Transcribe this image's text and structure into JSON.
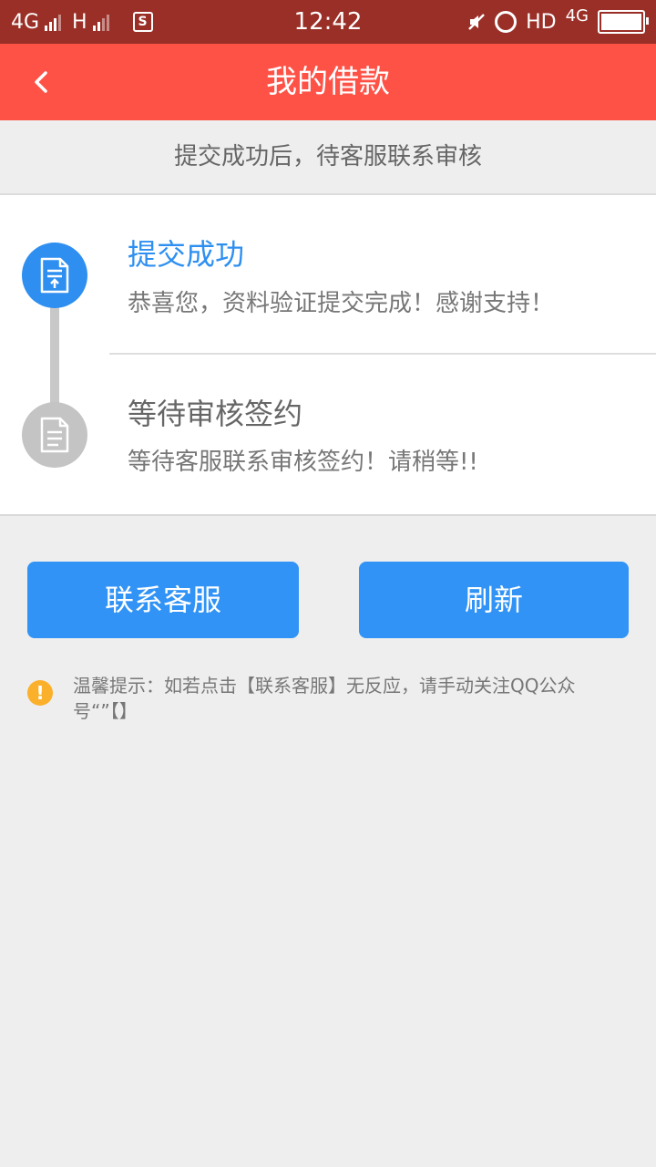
{
  "status_bar": {
    "network_1": "4G",
    "network_2": "H",
    "sim_icon_text": "S",
    "time": "12:42",
    "hd_label": "HD",
    "network_3": "4G"
  },
  "header": {
    "title": "我的借款",
    "back_icon": "chevron-left-icon"
  },
  "notice": {
    "text": "提交成功后，待客服联系审核"
  },
  "steps": [
    {
      "title": "提交成功",
      "description": "恭喜您，资料验证提交完成！感谢支持！",
      "state": "completed",
      "icon": "document-upload-icon",
      "color": "#2e8ff0"
    },
    {
      "title": "等待审核签约",
      "description": "等待客服联系审核签约！请稍等!!",
      "state": "pending",
      "icon": "document-icon",
      "color": "#c4c4c4"
    }
  ],
  "buttons": {
    "contact_label": "联系客服",
    "refresh_label": "刷新"
  },
  "tip": {
    "icon": "warning-icon",
    "icon_glyph": "!",
    "text": "温馨提示：如若点击【联系客服】无反应，请手动关注QQ公众号“”【】"
  },
  "colors": {
    "header_bg": "#ff5247",
    "status_bar_bg": "#9a2f27",
    "button_bg": "#3193f5",
    "active_step": "#2e8ff0",
    "warning": "#fbb02c"
  }
}
